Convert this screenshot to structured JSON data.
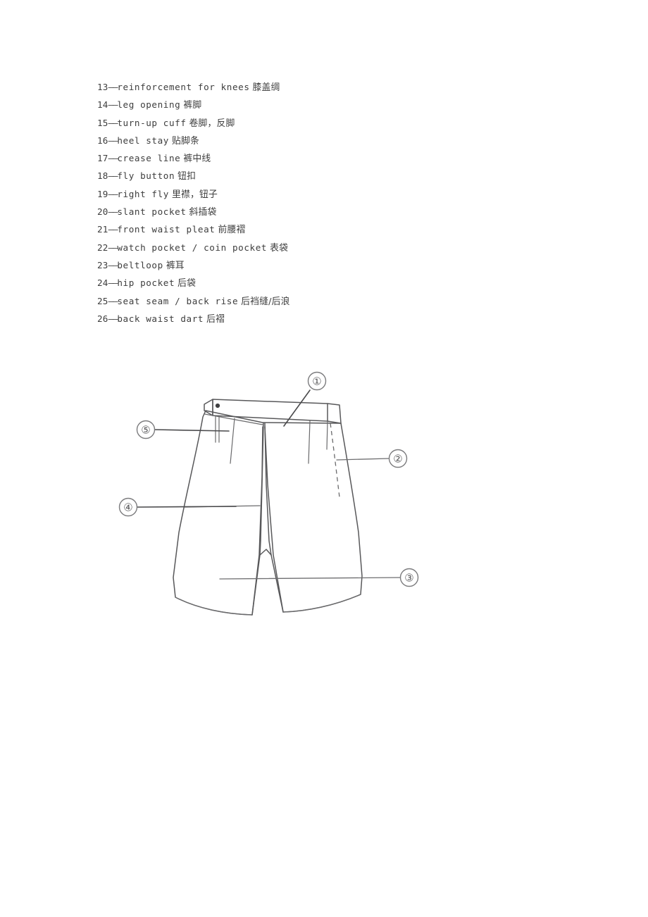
{
  "document": {
    "background_color": "#ffffff",
    "ink_color": "#58585a",
    "text_color": "#3d3d3d"
  },
  "glossary": {
    "items": [
      {
        "num": "13",
        "dash": "——",
        "en": "reinforcement for knees",
        "zh": "膝盖绸"
      },
      {
        "num": "14",
        "dash": "——",
        "en": "leg opening",
        "zh": "裤脚"
      },
      {
        "num": "15",
        "dash": "——",
        "en": "turn-up cuff",
        "zh": "卷脚，反脚"
      },
      {
        "num": "16",
        "dash": "——",
        "en": "heel stay",
        "zh": "贴脚条"
      },
      {
        "num": "17",
        "dash": "——",
        "en": "crease line",
        "zh": "裤中线"
      },
      {
        "num": "18",
        "dash": "——",
        "en": "fly button",
        "zh": "钮扣"
      },
      {
        "num": "19",
        "dash": "——",
        "en": "right fly",
        "zh": "里襟，钮子"
      },
      {
        "num": "20",
        "dash": "——",
        "en": "slant pocket",
        "zh": "斜插袋"
      },
      {
        "num": "21",
        "dash": "——",
        "en": "front waist pleat",
        "zh": "前腰褶"
      },
      {
        "num": "22",
        "dash": "——",
        "en": "watch pocket / coin pocket",
        "zh": "表袋"
      },
      {
        "num": "23",
        "dash": "——",
        "en": "beltloop",
        "zh": "裤耳"
      },
      {
        "num": "24",
        "dash": "——",
        "en": "hip pocket",
        "zh": "后袋"
      },
      {
        "num": "25",
        "dash": "——",
        "en": "seat seam / back rise",
        "zh": "后裆缝/后浪"
      },
      {
        "num": "26",
        "dash": "——",
        "en": "back waist dart",
        "zh": "后褶"
      }
    ]
  },
  "figure": {
    "description": "technical line drawing of shorts / trousers front view",
    "callouts": [
      {
        "id": "1",
        "label": "①",
        "position": "top-right",
        "points_to": "waistband"
      },
      {
        "id": "2",
        "label": "②",
        "position": "right",
        "points_to": "side-seam-dashed"
      },
      {
        "id": "3",
        "label": "③",
        "position": "lower-right",
        "points_to": "inseam"
      },
      {
        "id": "4",
        "label": "④",
        "position": "left",
        "points_to": "hip-line"
      },
      {
        "id": "5",
        "label": "⑤",
        "position": "upper-left",
        "points_to": "beltloop"
      }
    ]
  }
}
